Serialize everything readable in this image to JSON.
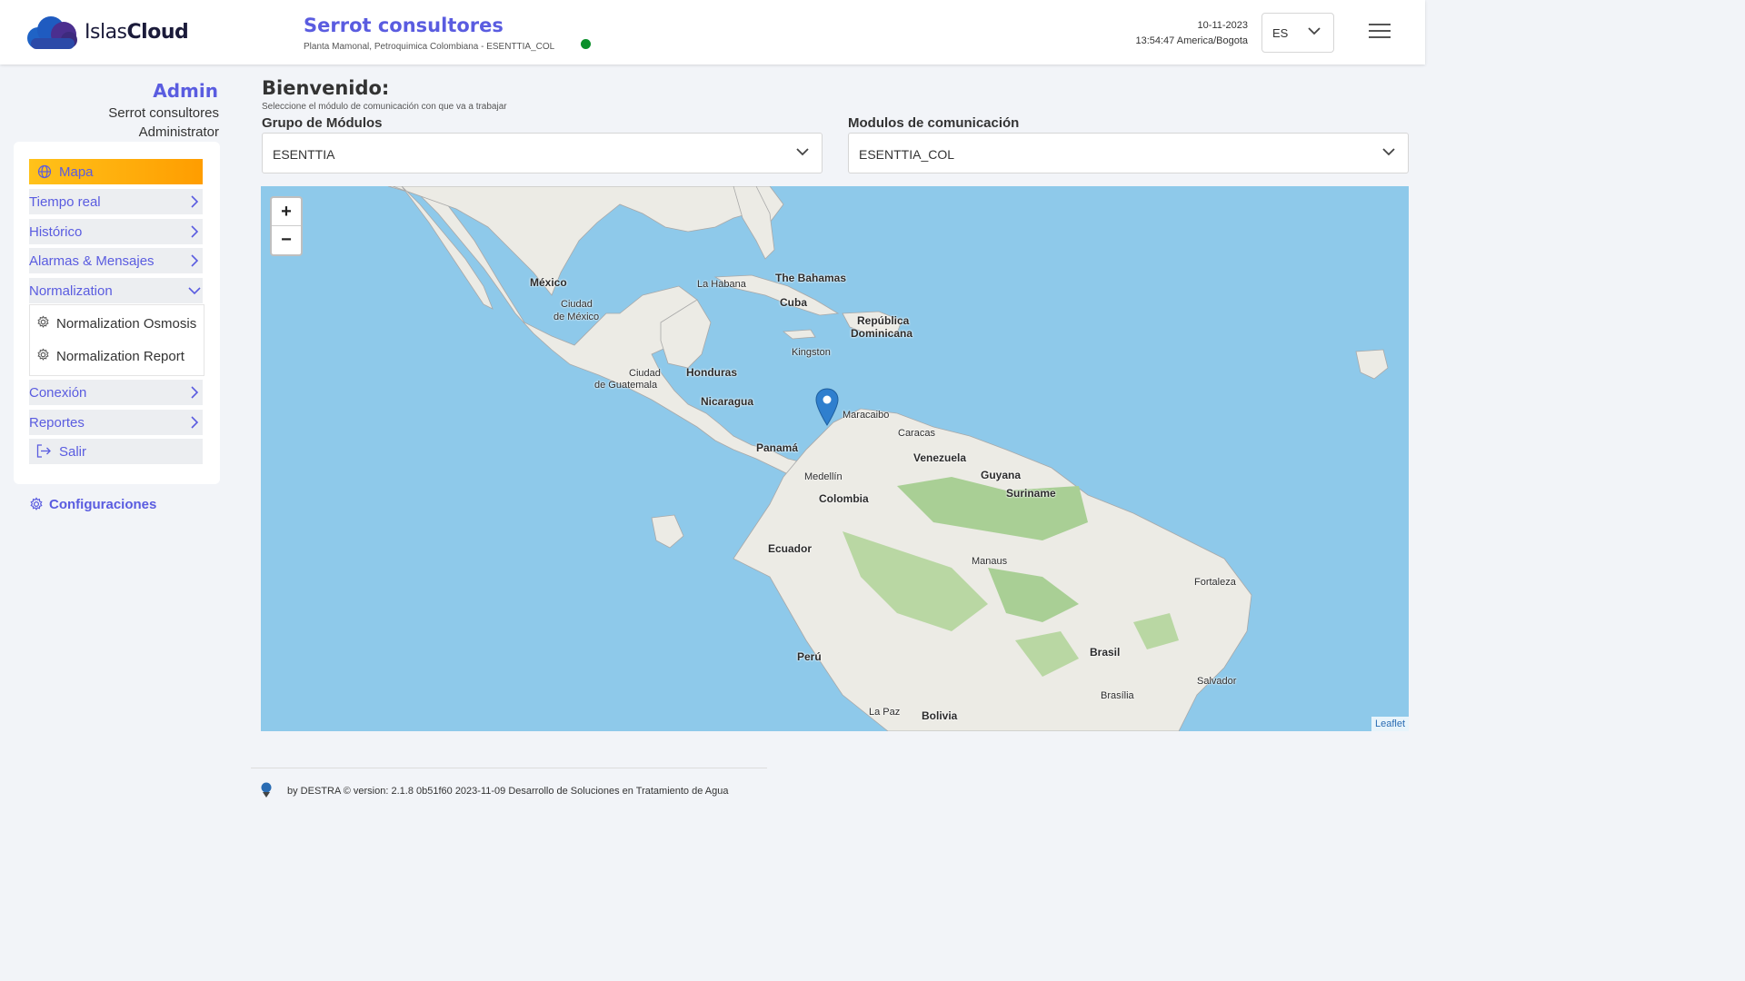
{
  "header": {
    "brand_light": "Islas",
    "brand_bold": "Cloud",
    "company": "Serrot consultores",
    "plant": "Planta Mamonal, Petroquimica Colombiana - ESENTTIA_COL",
    "status_color": "#0a8f2a",
    "date": "10-11-2023",
    "time": "13:54:47 America/Bogota",
    "language": "ES"
  },
  "sidebar": {
    "role_title": "Admin",
    "user_company": "Serrot consultores",
    "user_role": "Administrator",
    "items": [
      {
        "label": "Mapa",
        "icon": "globe-icon",
        "active": true
      },
      {
        "label": "Tiempo real",
        "icon": "chevron-right-icon"
      },
      {
        "label": "Histórico",
        "icon": "chevron-right-icon"
      },
      {
        "label": "Alarmas & Mensajes",
        "icon": "chevron-right-icon"
      },
      {
        "label": "Normalization",
        "icon": "chevron-down-icon",
        "expanded": true
      },
      {
        "label": "Conexión",
        "icon": "chevron-right-icon"
      },
      {
        "label": "Reportes",
        "icon": "chevron-right-icon"
      },
      {
        "label": "Salir",
        "icon": "logout-icon"
      }
    ],
    "sub_items": [
      {
        "label": "Normalization Osmosis",
        "icon": "gear-icon"
      },
      {
        "label": "Normalization Report",
        "icon": "gear-icon"
      }
    ],
    "config": "Configuraciones"
  },
  "main": {
    "welcome": "Bienvenido:",
    "welcome_sub": "Seleccione el módulo de comunicación con que va a trabajar",
    "group_label": "Grupo de Módulos",
    "group_value": "ESENTTIA",
    "module_label": "Modulos de comunicación",
    "module_value": "ESENTTIA_COL"
  },
  "map": {
    "zoom_in": "+",
    "zoom_out": "−",
    "attribution": "Leaflet",
    "labels": [
      "México",
      "Ciudad",
      "de México",
      "La Habana",
      "The Bahamas",
      "Cuba",
      "República",
      "Dominicana",
      "Kingston",
      "Ciudad",
      "de Guatemala",
      "Honduras",
      "Nicaragua",
      "Maracaibo",
      "Caracas",
      "Panamá",
      "Venezuela",
      "Guyana",
      "Suriname",
      "Medellín",
      "Colombia",
      "Ecuador",
      "Manaus",
      "Fortaleza",
      "Perú",
      "Brasil",
      "Salvador",
      "Brasília",
      "La Paz",
      "Bolivia"
    ]
  },
  "footer": {
    "text": "by  DESTRA ©   version: 2.1.8   0b51f60   2023-11-09     Desarrollo de Soluciones en Tratamiento de Agua"
  }
}
